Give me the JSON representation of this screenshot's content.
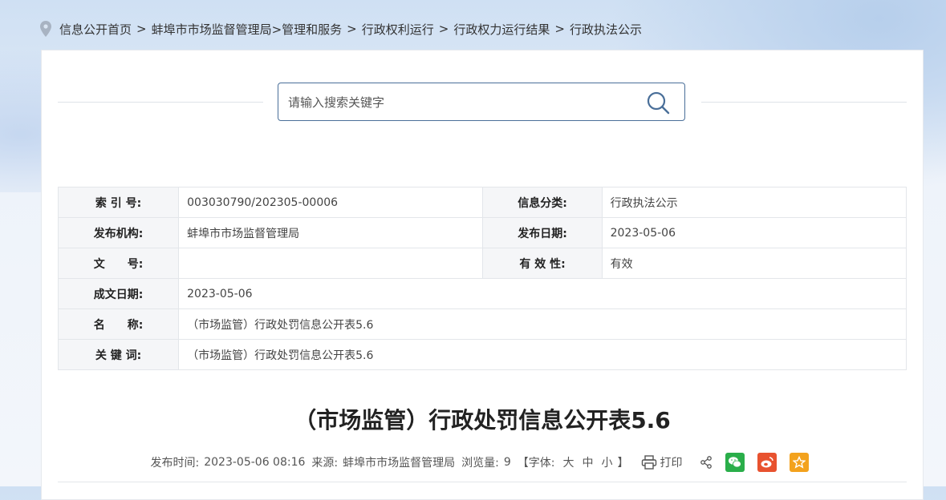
{
  "breadcrumb": {
    "items": [
      "信息公开首页",
      "蚌埠市市场监督管理局>管理和服务",
      "行政权利运行",
      "行政权力运行结果",
      "行政执法公示"
    ],
    "sep": ">"
  },
  "search": {
    "placeholder": "请输入搜索关键字"
  },
  "meta": {
    "index_label": "索 引 号:",
    "index_value": "003030790/202305-00006",
    "category_label": "信息分类:",
    "category_value": "行政执法公示",
    "org_label": "发布机构:",
    "org_value": "蚌埠市市场监督管理局",
    "pubdate_label": "发布日期:",
    "pubdate_value": "2023-05-06",
    "docno_label": "文　　号:",
    "docno_value": "",
    "validity_label": "有 效 性:",
    "validity_value": "有效",
    "created_label": "成文日期:",
    "created_value": "2023-05-06",
    "name_label": "名　　称:",
    "name_value": "（市场监管）行政处罚信息公开表5.6",
    "keywords_label": "关 键 词:",
    "keywords_value": "（市场监管）行政处罚信息公开表5.6"
  },
  "article": {
    "title": "（市场监管）行政处罚信息公开表5.6",
    "pubtime_label": "发布时间:",
    "pubtime_value": "2023-05-06 08:16",
    "source_label": "来源:",
    "source_value": "蚌埠市市场监督管理局",
    "views_label": "浏览量:",
    "views_value": "9",
    "font_open": "【字体:",
    "font_large": "大",
    "font_medium": "中",
    "font_small": "小",
    "font_close": "】",
    "print_label": "打印"
  },
  "colors": {
    "accent": "#4a6f99",
    "wechat": "#2aae4a",
    "weibo": "#e8522f",
    "favorite": "#f3a21d"
  },
  "icons": [
    "location-pin-icon",
    "search-icon",
    "print-icon",
    "share-icon",
    "wechat-icon",
    "weibo-icon",
    "star-icon"
  ]
}
